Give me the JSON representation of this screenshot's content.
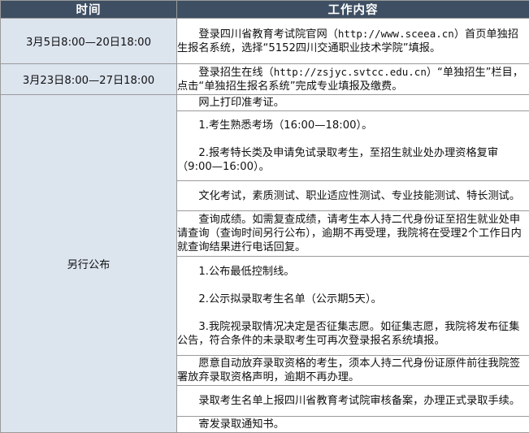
{
  "header": {
    "time": "时间",
    "content": "工作内容"
  },
  "rows": [
    {
      "time": "3月5日8:00—20日18:00",
      "paragraphs": [
        {
          "pre": "登录四川省教育考试院官网（",
          "url": "http://www.sceea.cn",
          "post": "）首页单独招生报名系统，选择“5152四川交通职业技术学院”填报。"
        }
      ]
    },
    {
      "time": "3月23日8:00—27日18:00",
      "paragraphs": [
        {
          "pre": "登录招生在线（",
          "url": "http://zsjyc.svtcc.edu.cn",
          "post": "）“单独招生”栏目，点击“单独招生报名系统”完成专业填报及缴费。"
        }
      ]
    },
    {
      "time": "另行公布",
      "cells": [
        {
          "paragraphs": [
            "网上打印准考证。"
          ]
        },
        {
          "paragraphs": [
            "1.考生熟悉考场（16:00—18:00）。",
            "2.报考特长类及申请免试录取考生，至招生就业处办理资格复审（9:00—16:00）。"
          ]
        },
        {
          "paragraphs": [
            "文化考试，素质测试、职业适应性测试、专业技能测试、特长测试。"
          ]
        },
        {
          "paragraphs": [
            "查询成绩。如需复查成绩，请考生本人持二代身份证至招生就业处申请查询（查询时间另行公布），逾期不再受理，我院将在受理2个工作日内就查询结果进行电话回复。"
          ]
        },
        {
          "paragraphs": [
            "1.公布最低控制线。",
            "2.公示拟录取考生名单（公示期5天）。",
            "3.我院视录取情况决定是否征集志愿。如征集志愿，我院将发布征集公告，符合条件的未录取考生可再次登录报名系统填报。"
          ]
        },
        {
          "paragraphs": [
            "愿意自动放弃录取资格的考生，须本人持二代身份证原件前往我院签署放弃录取资格声明，逾期不再办理。"
          ]
        },
        {
          "paragraphs": [
            "录取考生名单上报四川省教育考试院审核备案，办理正式录取手续。"
          ]
        },
        {
          "paragraphs": [
            "寄发录取通知书。"
          ]
        }
      ]
    }
  ]
}
